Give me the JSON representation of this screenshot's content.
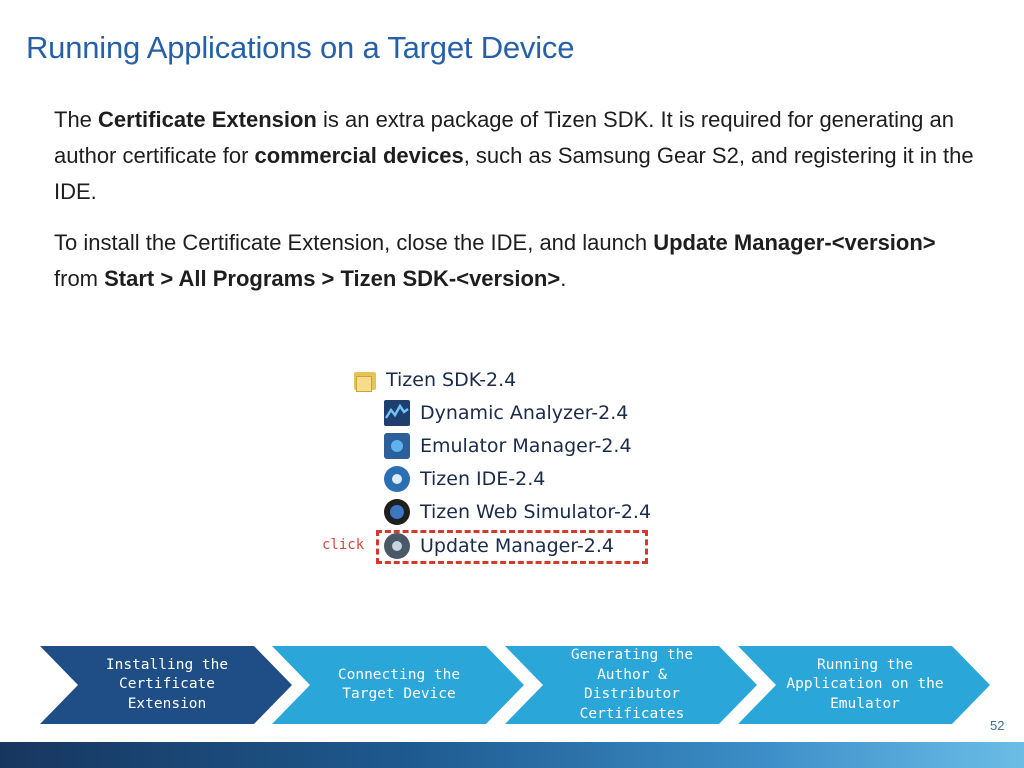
{
  "slide": {
    "title": "Running Applications on a Target Device",
    "page_number": "52"
  },
  "para1": {
    "t1": "The ",
    "b1": "Certificate Extension",
    "t2": " is an extra package of Tizen SDK. It is required for generating an author certificate for ",
    "b2": "commercial devices",
    "t3": ", such as Samsung Gear S2, and registering it in the IDE."
  },
  "para2": {
    "t1": "To install the Certificate Extension, close the IDE, and launch ",
    "b1": "Update Manager-<version>",
    "t2": " from ",
    "b2": "Start > All Programs > Tizen SDK-<version>",
    "t3": "."
  },
  "start_menu": {
    "folder": "Tizen SDK-2.4",
    "items": [
      {
        "label": "Dynamic Analyzer-2.4",
        "icon": "dynamic-analyzer-icon"
      },
      {
        "label": "Emulator Manager-2.4",
        "icon": "emulator-manager-icon"
      },
      {
        "label": "Tizen IDE-2.4",
        "icon": "tizen-ide-icon"
      },
      {
        "label": "Tizen Web Simulator-2.4",
        "icon": "web-simulator-icon"
      },
      {
        "label": "Update Manager-2.4",
        "icon": "update-manager-icon"
      }
    ],
    "click_note": "click",
    "highlight_color": "#d23a2e"
  },
  "steps": [
    {
      "label": "Installing the Certificate Extension",
      "color": "#1f4e86"
    },
    {
      "label": "Connecting the Target Device",
      "color": "#2aa6d9"
    },
    {
      "label": "Generating the Author & Distributor Certificates",
      "color": "#2aa6d9"
    },
    {
      "label": "Running the Application on the Emulator",
      "color": "#2aa6d9"
    }
  ],
  "colors": {
    "title": "#2660a8",
    "active_step": "#1f4e86",
    "inactive_step": "#2aa6d9"
  }
}
